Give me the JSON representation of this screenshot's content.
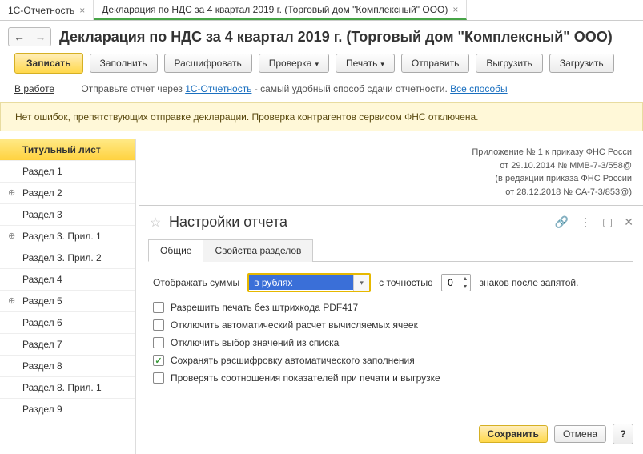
{
  "tabs": [
    {
      "label": "1С-Отчетность",
      "closable": true,
      "active": false
    },
    {
      "label": "Декларация по НДС за 4 квартал 2019 г. (Торговый дом \"Комплексный\" ООО)",
      "closable": true,
      "active": true
    }
  ],
  "page_title": "Декларация по НДС за 4 квартал 2019 г. (Торговый дом \"Комплексный\" ООО)",
  "toolbar": {
    "save": "Записать",
    "fill": "Заполнить",
    "decrypt": "Расшифровать",
    "check": "Проверка",
    "print": "Печать",
    "send": "Отправить",
    "export": "Выгрузить",
    "import": "Загрузить"
  },
  "status": {
    "label": "В работе",
    "hint_prefix": "Отправьте отчет через ",
    "hint_link1": "1С-Отчетность",
    "hint_mid": " - самый удобный способ сдачи отчетности. ",
    "hint_link2": "Все способы"
  },
  "banner": "Нет ошибок, препятствующих отправке декларации. Проверка контрагентов сервисом ФНС отключена.",
  "sidebar": [
    {
      "label": "Титульный лист",
      "expand": false,
      "selected": true
    },
    {
      "label": "Раздел 1",
      "expand": false
    },
    {
      "label": "Раздел 2",
      "expand": true
    },
    {
      "label": "Раздел 3",
      "expand": false
    },
    {
      "label": "Раздел 3. Прил. 1",
      "expand": true
    },
    {
      "label": "Раздел 3. Прил. 2",
      "expand": false
    },
    {
      "label": "Раздел 4",
      "expand": false
    },
    {
      "label": "Раздел 5",
      "expand": true
    },
    {
      "label": "Раздел 6",
      "expand": false
    },
    {
      "label": "Раздел 7",
      "expand": false
    },
    {
      "label": "Раздел 8",
      "expand": false
    },
    {
      "label": "Раздел 8. Прил. 1",
      "expand": false
    },
    {
      "label": "Раздел 9",
      "expand": false
    }
  ],
  "content_ref": {
    "line1": "Приложение № 1 к приказу ФНС Росси",
    "line2": "от 29.10.2014 № ММВ-7-3/558@",
    "line3": "(в редакции приказа ФНС России",
    "line4": "от 28.12.2018 № СА-7-3/853@)"
  },
  "dialog": {
    "title": "Настройки отчета",
    "tabs": {
      "general": "Общие",
      "props": "Свойства разделов"
    },
    "row1": {
      "label": "Отображать суммы",
      "value": "в рублях",
      "precision_label": "с точностью",
      "precision_value": "0",
      "suffix": "знаков после запятой."
    },
    "checks": [
      {
        "label": "Разрешить печать без штрихкода PDF417",
        "checked": false
      },
      {
        "label": "Отключить автоматический расчет вычисляемых ячеек",
        "checked": false
      },
      {
        "label": "Отключить выбор значений из списка",
        "checked": false
      },
      {
        "label": "Сохранять расшифровку автоматического заполнения",
        "checked": true
      },
      {
        "label": "Проверять соотношения показателей при печати и выгрузке",
        "checked": false
      }
    ],
    "footer": {
      "save": "Сохранить",
      "cancel": "Отмена",
      "help": "?"
    }
  }
}
